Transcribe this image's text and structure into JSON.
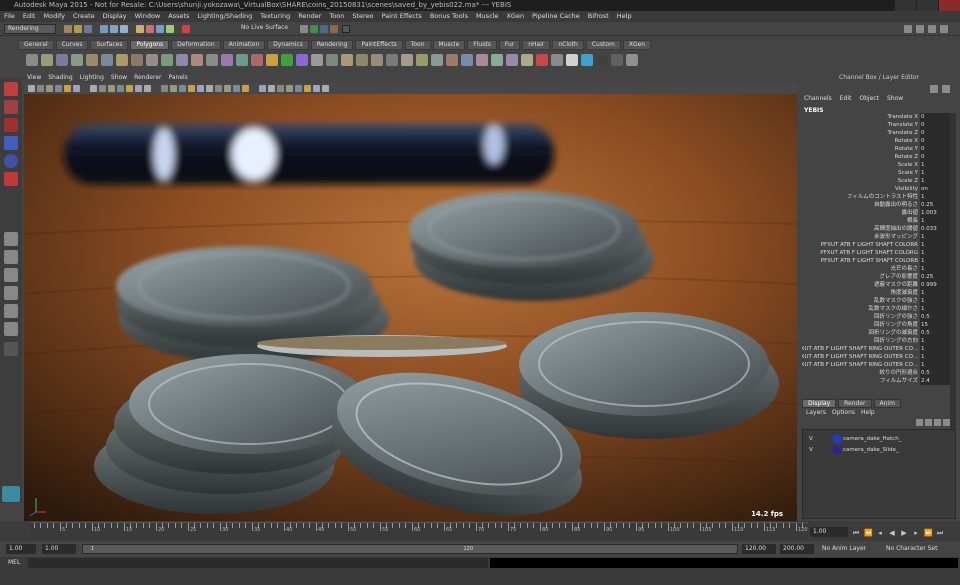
{
  "window": {
    "title": "Autodesk Maya 2015 - Not for Resale: C:\\Users\\shunji.yokozawa\\_VirtualBox\\SHARE\\coins_20150831\\scenes\\saved_by_yebis022.ma*   ---   YEBIS"
  },
  "menubar": [
    "File",
    "Edit",
    "Modify",
    "Create",
    "Display",
    "Window",
    "Assets",
    "Lighting/Shading",
    "Texturing",
    "Render",
    "Toon",
    "Stereo",
    "Paint Effects",
    "Bonus Tools",
    "Muscle",
    "XGen",
    "Pipeline Cache",
    "Bifrost",
    "Help"
  ],
  "statusline": {
    "menuset": "Rendering",
    "live_surface": "No Live Surface"
  },
  "shelf_tabs": [
    "General",
    "Curves",
    "Surfaces",
    "Polygons",
    "Deformation",
    "Animation",
    "Dynamics",
    "Rendering",
    "PaintEffects",
    "Toon",
    "Muscle",
    "Fluids",
    "Fur",
    "nHair",
    "nCloth",
    "Custom",
    "XGen"
  ],
  "shelf_active": "Polygons",
  "panel_menu": [
    "View",
    "Shading",
    "Lighting",
    "Show",
    "Renderer",
    "Panels"
  ],
  "viewport": {
    "fps": "14.2 fps"
  },
  "channel_box": {
    "title": "Channel Box / Layer Editor",
    "menu": [
      "Channels",
      "Edit",
      "Object",
      "Show"
    ],
    "object": "YEBIS",
    "attributes": [
      {
        "name": "Translate X",
        "value": "0"
      },
      {
        "name": "Translate Y",
        "value": "0"
      },
      {
        "name": "Translate Z",
        "value": "0"
      },
      {
        "name": "Rotate X",
        "value": "0"
      },
      {
        "name": "Rotate Y",
        "value": "0"
      },
      {
        "name": "Rotate Z",
        "value": "0"
      },
      {
        "name": "Scale X",
        "value": "1"
      },
      {
        "name": "Scale Y",
        "value": "1"
      },
      {
        "name": "Scale Z",
        "value": "1"
      },
      {
        "name": "Visibility",
        "value": "on"
      },
      {
        "name": "フィルムのコントラスト特性",
        "value": "1"
      },
      {
        "name": "自動露出の明るさ",
        "value": "0.25"
      },
      {
        "name": "露出値",
        "value": "1.003"
      },
      {
        "name": "横長",
        "value": "1"
      },
      {
        "name": "高輝度抽出の閾値",
        "value": "0.033"
      },
      {
        "name": "余波形マッピング",
        "value": "1"
      },
      {
        "name": "PFXUT ATB F LIGHT SHAFT COLORR",
        "value": "1"
      },
      {
        "name": "PFXUT ATB F LIGHT SHAFT COLORG",
        "value": "1"
      },
      {
        "name": "PFXUT ATB F LIGHT SHAFT COLORB",
        "value": "1"
      },
      {
        "name": "光芒の長さ",
        "value": "1"
      },
      {
        "name": "グレアの影響度",
        "value": "0.25"
      },
      {
        "name": "遮蔽マスクの距離",
        "value": "0.999"
      },
      {
        "name": "角度減衰度",
        "value": "1"
      },
      {
        "name": "乱数マスクの強さ",
        "value": "1"
      },
      {
        "name": "乱数マスクの細かさ",
        "value": "1"
      },
      {
        "name": "回折リングの強さ",
        "value": "0.5"
      },
      {
        "name": "回折リングの角度",
        "value": "15"
      },
      {
        "name": "回折リングの減衰度",
        "value": "0.5"
      },
      {
        "name": "回折リングの方向",
        "value": "1"
      },
      {
        "name": "PFXUT ATB F LIGHT SHAFT RING OUTER CO...",
        "value": "1"
      },
      {
        "name": "PFXUT ATB F LIGHT SHAFT RING OUTER CO...",
        "value": "1"
      },
      {
        "name": "PFXUT ATB F LIGHT SHAFT RING OUTER CO...",
        "value": "1"
      },
      {
        "name": "絞りの円形適合",
        "value": "0.5"
      },
      {
        "name": "フィルムサイズ",
        "value": "2.4"
      }
    ]
  },
  "layer_editor": {
    "tabs": [
      "Display",
      "Render",
      "Anim"
    ],
    "active_tab": "Display",
    "menu": [
      "Layers",
      "Options",
      "Help"
    ],
    "layers": [
      {
        "visible": "V",
        "name": "camera_dake_Hatch_",
        "color": "#1f3fbf"
      },
      {
        "visible": "V",
        "name": "camera_dake_Slide_",
        "color": "#3a1f8a"
      }
    ]
  },
  "timeline": {
    "ticks": [
      "5",
      "10",
      "15",
      "20",
      "25",
      "30",
      "35",
      "40",
      "45",
      "50",
      "55",
      "60",
      "65",
      "70",
      "75",
      "80",
      "85",
      "90",
      "95",
      "100",
      "105",
      "110",
      "115",
      "120"
    ],
    "current_frame": "1.00"
  },
  "range": {
    "start": "1.00",
    "playback_start": "1.00",
    "range_start_label": "1",
    "range_end_label": "120",
    "playback_end": "120.00",
    "end": "200.00",
    "anim_layer": "No Anim Layer",
    "character_set": "No Character Set"
  },
  "cmdline": {
    "label": "MEL"
  }
}
